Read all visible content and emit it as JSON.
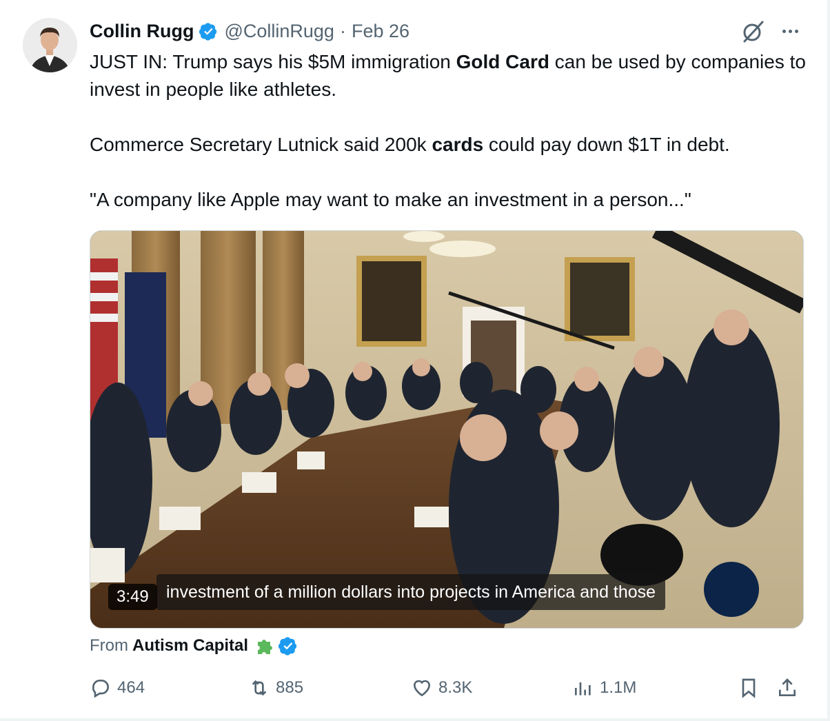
{
  "tweet": {
    "author_name": "Collin Rugg",
    "handle": "@CollinRugg",
    "separator": "·",
    "date": "Feb 26",
    "paragraphs": [
      {
        "pre": "JUST IN: Trump says his $5M immigration ",
        "bold": "Gold Card",
        "post": " can be used by companies to invest in people like athletes."
      },
      {
        "pre": "Commerce Secretary Lutnick said 200k ",
        "bold": "cards",
        "post": " could pay down $1T in debt."
      },
      {
        "pre": "\"A company like Apple may want to make an investment in a person...\"",
        "bold": "",
        "post": ""
      }
    ]
  },
  "media": {
    "caption": "investment of a million dollars into projects in America and those",
    "duration": "3:49"
  },
  "from": {
    "label": "From",
    "source_name": "Autism Capital"
  },
  "actions": {
    "replies": "464",
    "reposts": "885",
    "likes": "8.3K",
    "views": "1.1M"
  },
  "colors": {
    "verified": "#1d9bf0",
    "text_primary": "#0f1419",
    "text_secondary": "#536471",
    "border": "#cfd9de",
    "puzzle": "#5cb85c"
  },
  "icons": {
    "verified": "verified-badge-icon",
    "grok": "grok-icon",
    "more": "more-icon",
    "reply": "reply-icon",
    "repost": "repost-icon",
    "like": "heart-icon",
    "views": "views-icon",
    "bookmark": "bookmark-icon",
    "share": "share-icon",
    "puzzle": "puzzle-piece-icon"
  }
}
